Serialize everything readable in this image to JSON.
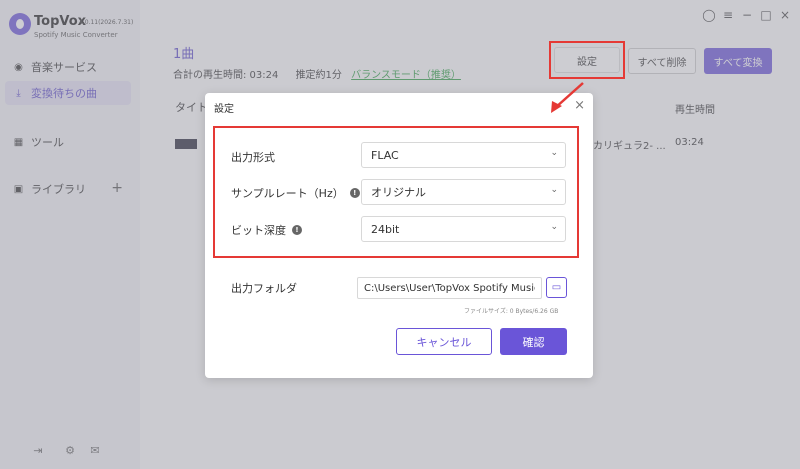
{
  "app": {
    "name": "TopVox",
    "version": "4.0.11(2026.7.31)",
    "subtitle": "Spotify Music Converter"
  },
  "sidebar": {
    "items": [
      {
        "label": "音楽サービス",
        "icon": "disc-icon"
      },
      {
        "label": "変換待ちの曲",
        "icon": "download-icon"
      },
      {
        "label": "ツール",
        "icon": "grid-icon"
      },
      {
        "label": "ライブラリ",
        "icon": "library-icon"
      }
    ],
    "bottom_icons": [
      "collapse-icon",
      "settings-gear-icon",
      "mail-icon"
    ]
  },
  "window_controls": [
    "account-icon",
    "menu-icon",
    "minimize-icon",
    "maximize-icon",
    "close-icon"
  ],
  "main": {
    "count": "1曲",
    "total_time": "合計の再生時間: 03:24",
    "estimate": "推定約1分",
    "mode": "バランスモード（推奨）",
    "buttons": {
      "settings": "設定",
      "delete_all": "すべて削除",
      "convert_all": "すべて変換"
    },
    "columns": {
      "title": "タイトル",
      "duration": "再生時間"
    },
    "row": {
      "artist": "カリギュラ2- ...",
      "duration": "03:24"
    }
  },
  "dialog": {
    "title": "設定",
    "close": "×",
    "fields": [
      {
        "label": "出力形式",
        "value": "FLAC",
        "info": false
      },
      {
        "label": "サンプルレート（Hz）",
        "value": "オリジナル",
        "info": true
      },
      {
        "label": "ビット深度",
        "value": "24bit",
        "info": true
      }
    ],
    "output_folder_label": "出力フォルダ",
    "output_folder_value": "C:\\Users\\User\\TopVox Spotify Music Converter",
    "file_size": "ファイルサイズ: 0 Bytes/6.26 GB",
    "cancel": "キャンセル",
    "ok": "確認"
  },
  "colors": {
    "accent": "#6a55d8",
    "highlight": "#e53935",
    "mode_green": "#2ea043"
  }
}
